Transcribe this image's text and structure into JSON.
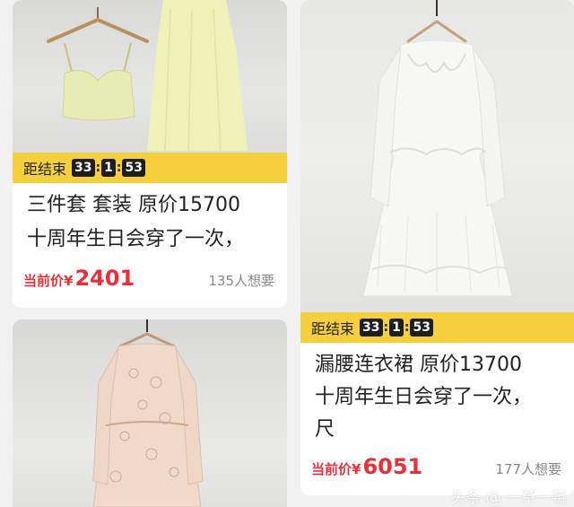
{
  "listings": [
    {
      "timer_label": "距结束",
      "timer": [
        "33",
        "1",
        "53"
      ],
      "title_line1": "三件套 套装   原价15700",
      "title_line2": "十周年生日会穿了一次，",
      "price_label": "当前价¥",
      "price": "2401",
      "want": "135人想要"
    },
    {
      "timer_label": "距结束",
      "timer": [
        "33",
        "1",
        "53"
      ],
      "title_line1": "漏腰连衣裙   原价13700",
      "title_line2": "十周年生日会穿了一次，",
      "title_line3": "尺",
      "price_label": "当前价¥",
      "price": "6051",
      "want": "177人想要"
    }
  ],
  "watermark": "头条 @ 一草一莓"
}
